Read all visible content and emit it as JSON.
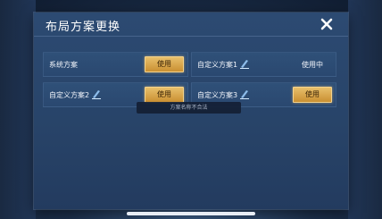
{
  "dialog": {
    "title": "布局方案更换",
    "close_icon": "close-icon"
  },
  "schemes": [
    {
      "label": "系统方案",
      "editable": false,
      "action": "使用",
      "state": "button"
    },
    {
      "label": "自定义方案1",
      "editable": true,
      "action": "使用中",
      "state": "in-use"
    },
    {
      "label": "自定义方案2",
      "editable": true,
      "action": "使用",
      "state": "button"
    },
    {
      "label": "自定义方案3",
      "editable": true,
      "action": "使用",
      "state": "button"
    }
  ],
  "toast": "方案名称不合法",
  "colors": {
    "accent_gold": "#d9a44c",
    "panel_blue": "#284469"
  }
}
